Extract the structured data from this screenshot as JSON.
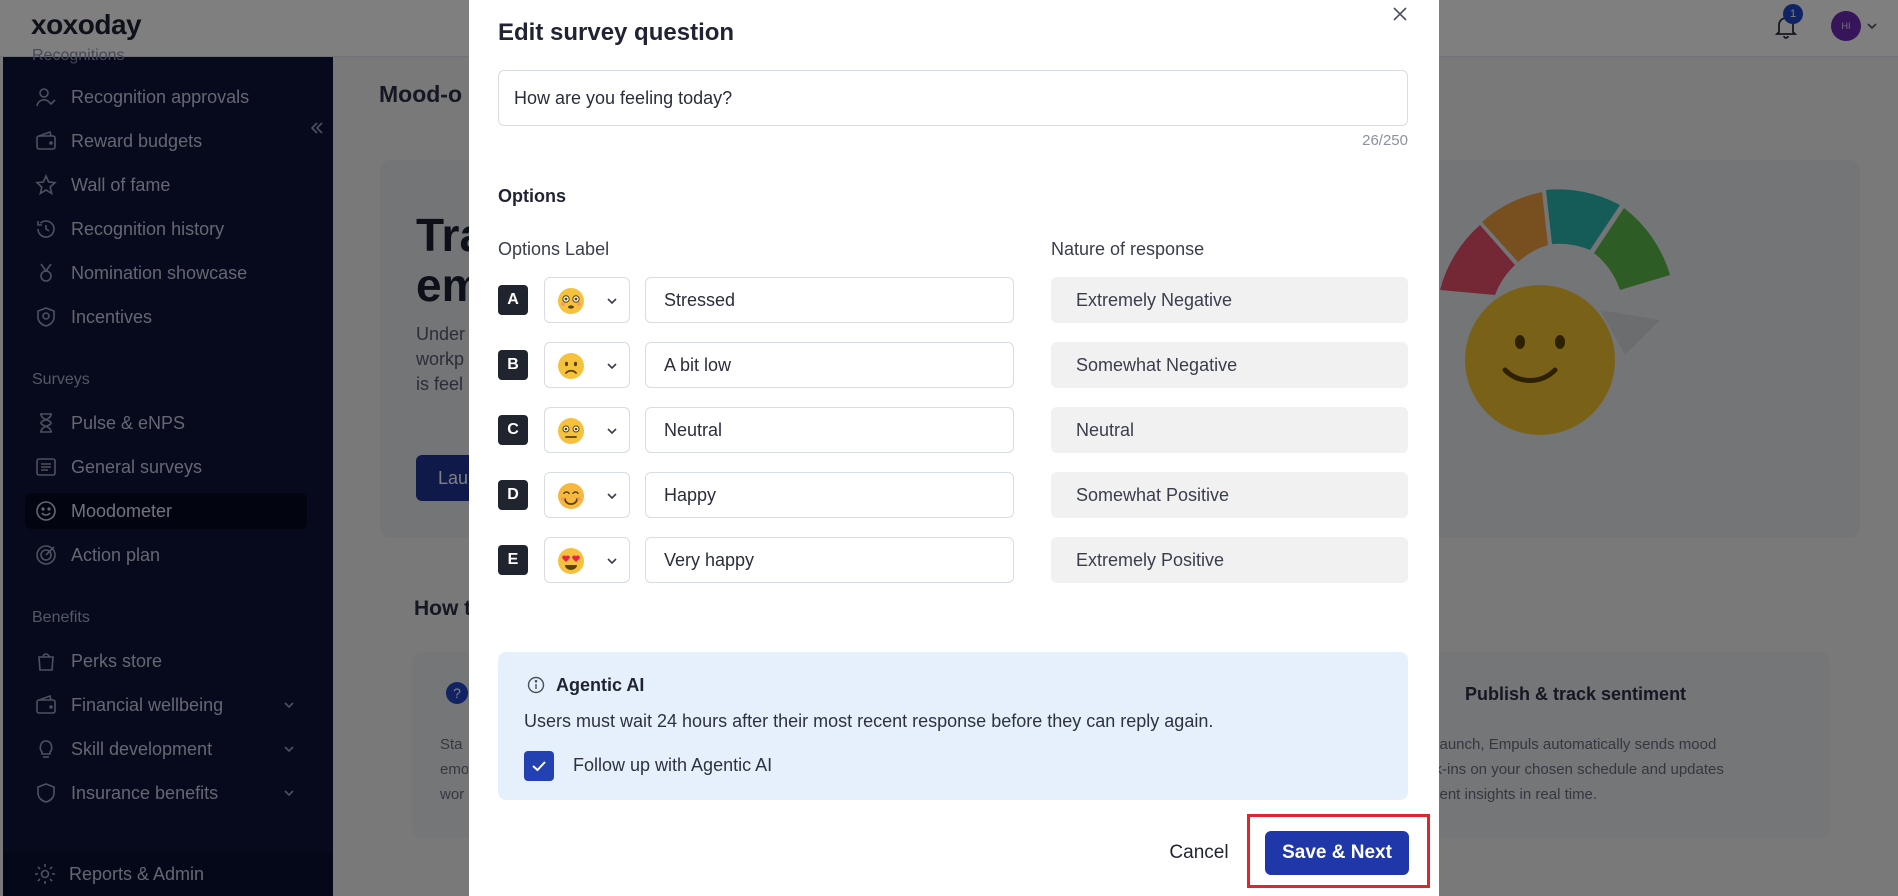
{
  "app": {
    "logo_text": "xoxoday",
    "notification_count": "1",
    "avatar_initials": "HI"
  },
  "sidebar": {
    "cut_section": "Recognitions",
    "recognition_items": [
      {
        "label": "Recognition approvals",
        "icon": "user-check-icon"
      },
      {
        "label": "Reward budgets",
        "icon": "wallet-icon"
      },
      {
        "label": "Wall of fame",
        "icon": "star-icon"
      },
      {
        "label": "Recognition history",
        "icon": "history-icon"
      },
      {
        "label": "Nomination showcase",
        "icon": "medal-icon"
      },
      {
        "label": "Incentives",
        "icon": "badge-icon"
      }
    ],
    "surveys_title": "Surveys",
    "survey_items": [
      {
        "label": "Pulse & eNPS",
        "icon": "hourglass-icon"
      },
      {
        "label": "General surveys",
        "icon": "list-icon"
      },
      {
        "label": "Moodometer",
        "icon": "smile-icon",
        "active": true
      },
      {
        "label": "Action plan",
        "icon": "target-icon"
      }
    ],
    "benefits_title": "Benefits",
    "benefit_items": [
      {
        "label": "Perks store",
        "icon": "bag-icon"
      },
      {
        "label": "Financial wellbeing",
        "icon": "wallet-icon"
      },
      {
        "label": "Skill development",
        "icon": "lightbulb-icon"
      },
      {
        "label": "Insurance benefits",
        "icon": "shield-icon"
      }
    ],
    "footer_label": "Reports & Admin"
  },
  "background": {
    "page_title_cut": "Mood-o",
    "hero_title_line1": "Tra",
    "hero_title_line2": "em",
    "hero_desc_line1": "Under",
    "hero_desc_line2": "workp",
    "hero_desc_line3": "is feel",
    "hero_button_cut": "Lau",
    "how_title_cut": "How t",
    "left_desc_line1": "Sta",
    "left_desc_line2": "emo",
    "left_desc_line3": "wor",
    "step_title": "Publish & track sentiment",
    "step_desc_line1": "r launch, Empuls automatically sends mood",
    "step_desc_line2": "ck-ins on your chosen schedule and updates",
    "step_desc_line3": "ment insights in real time."
  },
  "modal": {
    "title": "Edit survey question",
    "question_value": "How are you feeling today?",
    "char_count": "26/250",
    "options_heading": "Options",
    "options_label_header": "Options Label",
    "nature_header": "Nature of response",
    "options": [
      {
        "letter": "A",
        "emoji": "flushed-face-icon",
        "label": "Stressed",
        "nature": "Extremely Negative"
      },
      {
        "letter": "B",
        "emoji": "frowning-face-icon",
        "label": "A bit low",
        "nature": "Somewhat Negative"
      },
      {
        "letter": "C",
        "emoji": "neutral-face-icon",
        "label": "Neutral",
        "nature": "Neutral"
      },
      {
        "letter": "D",
        "emoji": "smiling-face-icon",
        "label": "Happy",
        "nature": "Somewhat Positive"
      },
      {
        "letter": "E",
        "emoji": "heart-eyes-face-icon",
        "label": "Very happy",
        "nature": "Extremely Positive"
      }
    ],
    "ai": {
      "title": "Agentic AI",
      "description": "Users must wait 24 hours after their most recent response before they can reply again.",
      "checkbox_label": "Follow up with Agentic AI",
      "checked": true
    },
    "cancel_label": "Cancel",
    "save_label": "Save & Next"
  },
  "colors": {
    "accent": "#1f37a8",
    "sidebar_bg": "#0f1538",
    "highlight": "#e0262c",
    "ai_box_bg": "#e6f0fc"
  }
}
